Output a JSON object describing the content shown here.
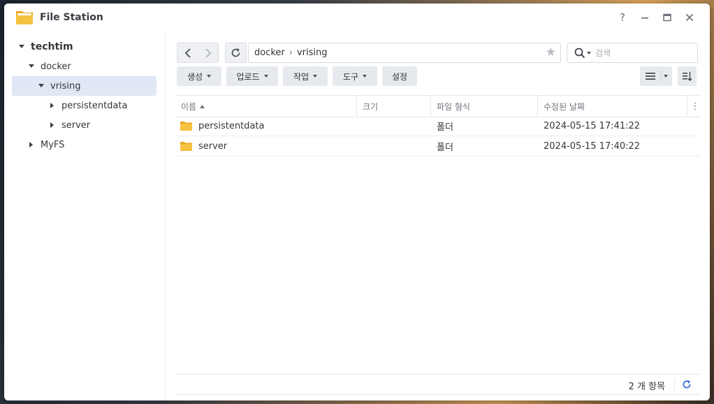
{
  "window": {
    "title": "File Station"
  },
  "sidebar": {
    "root": "techtim",
    "items": [
      {
        "label": "docker"
      },
      {
        "label": "vrising"
      },
      {
        "label": "persistentdata"
      },
      {
        "label": "server"
      },
      {
        "label": "MyFS"
      }
    ]
  },
  "toolbar": {
    "path": [
      "docker",
      "vrising"
    ],
    "path_separator": "›",
    "search_placeholder": "검색",
    "buttons": {
      "create": "생성",
      "upload": "업로드",
      "action": "작업",
      "tools": "도구",
      "settings": "설정"
    }
  },
  "table": {
    "columns": {
      "name": "이름",
      "size": "크기",
      "type": "파일 형식",
      "modified": "수정된 날짜"
    },
    "rows": [
      {
        "name": "persistentdata",
        "size": "",
        "type": "폴더",
        "modified": "2024-05-15 17:41:22"
      },
      {
        "name": "server",
        "size": "",
        "type": "폴더",
        "modified": "2024-05-15 17:40:22"
      }
    ]
  },
  "footer": {
    "count": "2 개 항목"
  },
  "colors": {
    "folder": "#f6c242",
    "selected": "#dfe8f4",
    "accent": "#2a6bd1"
  },
  "icons": [
    "folder-app-icon",
    "help-icon",
    "minimize-icon",
    "maximize-icon",
    "close-icon",
    "back-icon",
    "forward-icon",
    "refresh-icon",
    "star-icon",
    "search-icon",
    "list-view-icon",
    "sort-icon",
    "more-icon",
    "folder-icon"
  ]
}
